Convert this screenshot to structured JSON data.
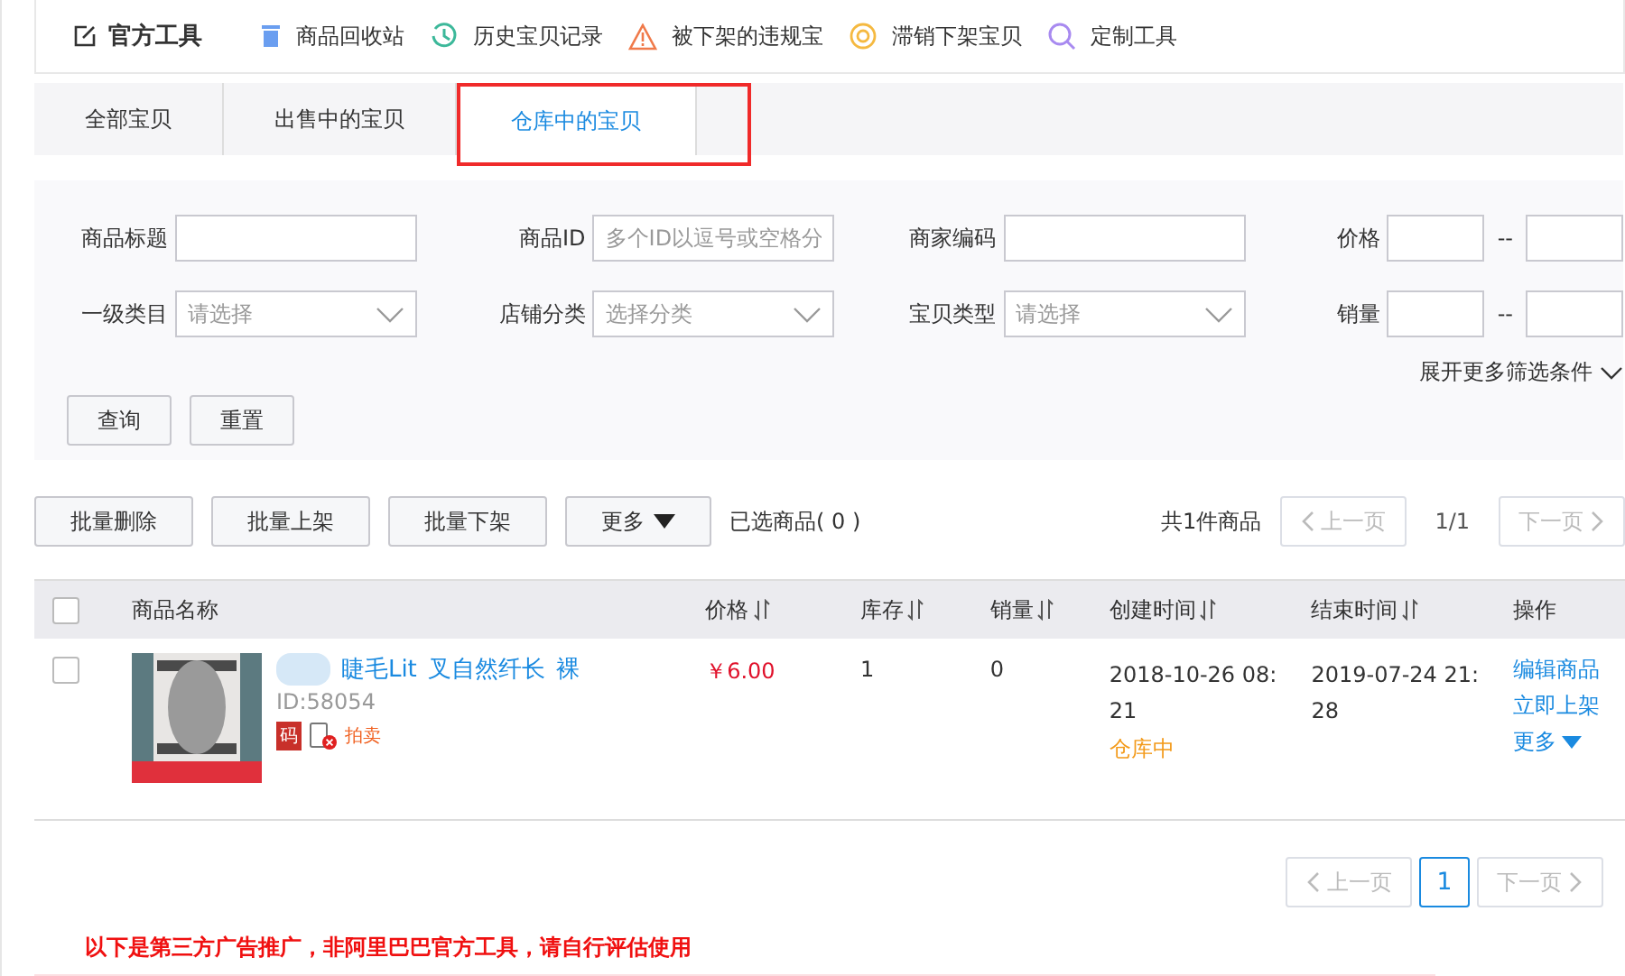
{
  "toolbar": {
    "title": "官方工具",
    "items": [
      {
        "label": "商品回收站",
        "kind": "trash"
      },
      {
        "label": "历史宝贝记录",
        "kind": "history"
      },
      {
        "label": "被下架的违规宝",
        "kind": "warning"
      },
      {
        "label": "滞销下架宝贝",
        "kind": "target"
      },
      {
        "label": "定制工具",
        "kind": "search"
      }
    ]
  },
  "tabs": [
    {
      "label": "全部宝贝",
      "selected": false
    },
    {
      "label": "出售中的宝贝",
      "selected": false
    },
    {
      "label": "仓库中的宝贝",
      "selected": true
    }
  ],
  "filters": {
    "rows": [
      [
        {
          "label": "商品标题",
          "kind": "text"
        },
        {
          "label": "商品ID",
          "kind": "text",
          "placeholder": "多个ID以逗号或空格分"
        },
        {
          "label": "商家编码",
          "kind": "text"
        },
        {
          "label": "价格",
          "kind": "range",
          "separator": "--"
        }
      ],
      [
        {
          "label": "一级类目",
          "kind": "select",
          "placeholder": "请选择"
        },
        {
          "label": "店铺分类",
          "kind": "select",
          "placeholder": "选择分类"
        },
        {
          "label": "宝贝类型",
          "kind": "select",
          "placeholder": "请选择"
        },
        {
          "label": "销量",
          "kind": "range",
          "separator": "--"
        }
      ]
    ],
    "expand": "展开更多筛选条件",
    "buttons": [
      "查询",
      "重置"
    ]
  },
  "actions": {
    "buttons": [
      {
        "label": "批量删除",
        "kind": "plain"
      },
      {
        "label": "批量上架",
        "kind": "plain"
      },
      {
        "label": "批量下架",
        "kind": "plain"
      },
      {
        "label": "更多",
        "kind": "dropdown"
      }
    ],
    "selected_count": "已选商品( 0 )",
    "total": "共1件商品",
    "prev": "上一页",
    "page": "1/1",
    "next": "下一页"
  },
  "table": {
    "all_checked": false,
    "columns": [
      {
        "label": "商品名称",
        "sortable": false
      },
      {
        "label": "价格",
        "sortable": true
      },
      {
        "label": "库存",
        "sortable": true
      },
      {
        "label": "销量",
        "sortable": true
      },
      {
        "label": "创建时间",
        "sortable": true
      },
      {
        "label": "结束时间",
        "sortable": true
      },
      {
        "label": "操作",
        "sortable": false
      }
    ],
    "rows": [
      {
        "checked": false,
        "title_parts": [
          "睫毛Lit",
          "叉自然纤长",
          "裸"
        ],
        "id": "ID:58054",
        "badge": "码",
        "tag": "拍卖",
        "price": "￥6.00",
        "stock": "1",
        "sales": "0",
        "created": "2018-10-26 08:21",
        "status": "仓库中",
        "ended": "2019-07-24 21:28",
        "ops": [
          "编辑商品",
          "立即上架"
        ],
        "more": "更多"
      }
    ]
  },
  "pagination": {
    "prev": "上一页",
    "pages": [
      {
        "label": "1",
        "selected": true
      }
    ],
    "next": "下一页"
  },
  "notice": "以下是第三方广告推广，非阿里巴巴官方工具，请自行评估使用"
}
